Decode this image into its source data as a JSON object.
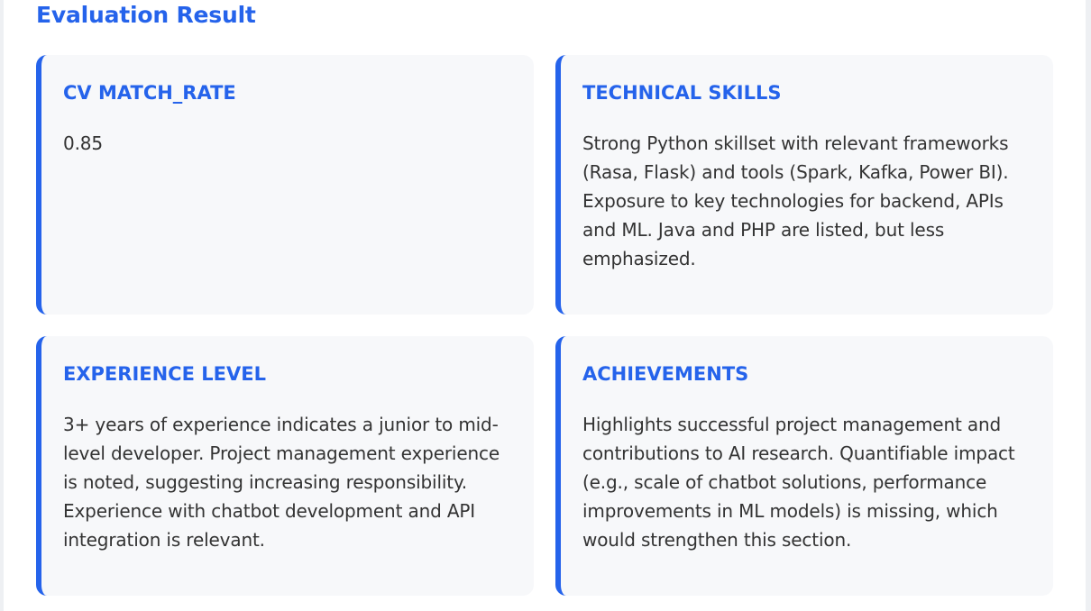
{
  "header": {
    "title": "Evaluation Result"
  },
  "cards": [
    {
      "title": "CV MATCH_RATE",
      "body": "0.85"
    },
    {
      "title": "TECHNICAL SKILLS",
      "body": "Strong Python skillset with relevant frameworks (Rasa, Flask) and tools (Spark, Kafka, Power BI). Exposure to key technologies for backend, APIs and ML. Java and PHP are listed, but less emphasized."
    },
    {
      "title": "EXPERIENCE LEVEL",
      "body": "3+ years of experience indicates a junior to mid-level developer. Project management experience is noted, suggesting increasing responsibility. Experience with chatbot development and API integration is relevant."
    },
    {
      "title": "ACHIEVEMENTS",
      "body": "Highlights successful project management and contributions to AI research. Quantifiable impact (e.g., scale of chatbot solutions, performance improvements in ML models) is missing, which would strengthen this section."
    }
  ],
  "colors": {
    "accent": "#2563eb",
    "card_background": "#f7f8fa",
    "body_text": "#333333"
  }
}
